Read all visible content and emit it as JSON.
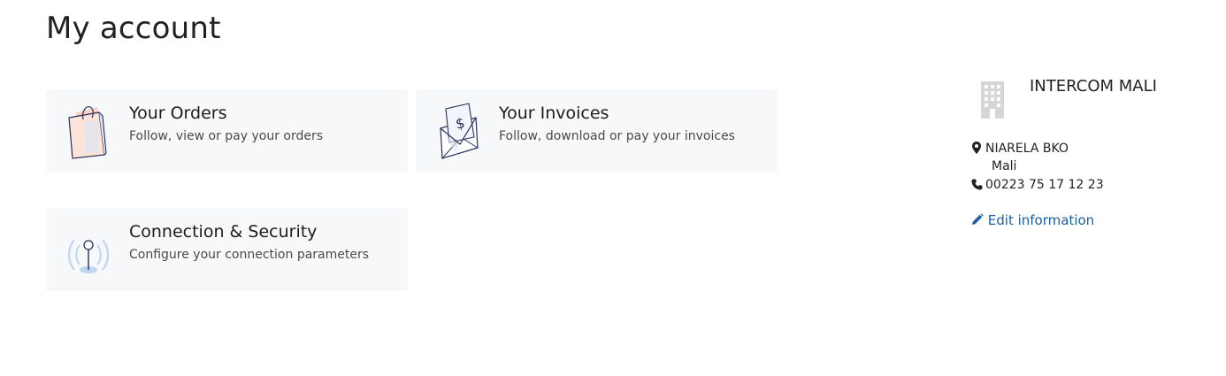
{
  "page": {
    "title": "My account"
  },
  "cards": {
    "orders": {
      "title": "Your Orders",
      "description": "Follow, view or pay your orders",
      "icon": "shopping-bag-icon"
    },
    "invoices": {
      "title": "Your Invoices",
      "description": "Follow, download or pay your invoices",
      "icon": "invoice-envelope-icon"
    },
    "security": {
      "title": "Connection & Security",
      "description": "Configure your connection parameters",
      "icon": "antenna-icon"
    }
  },
  "company": {
    "name": "INTERCOM MALI",
    "icon": "building-icon",
    "address_line1": "NIARELA BKO",
    "address_line2": "Mali",
    "phone": "00223 75 17 12 23",
    "edit_label": "Edit information"
  },
  "colors": {
    "link": "#1c5d9c",
    "card_bg": "#f7f8fa",
    "icon_accent": "#f6c9b8",
    "icon_blue": "#bcd5f0"
  }
}
